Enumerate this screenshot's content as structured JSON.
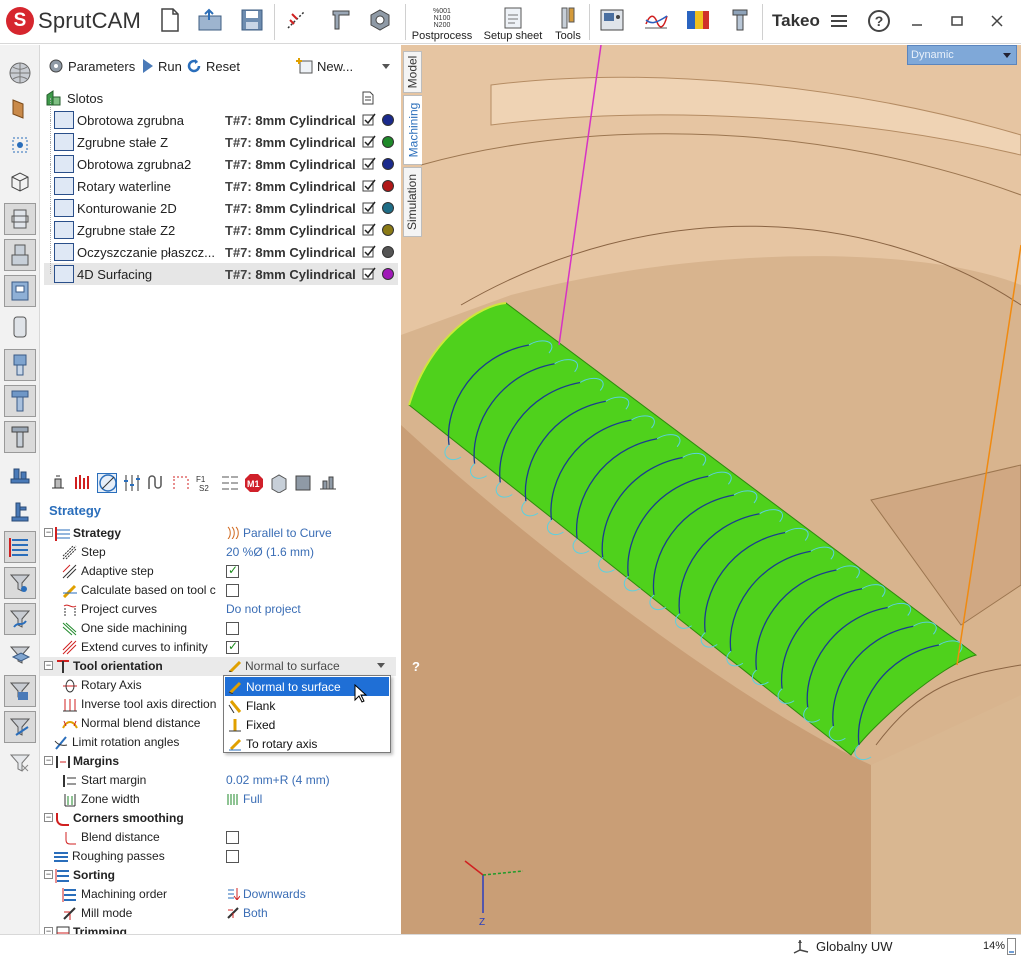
{
  "app": {
    "logo_letter": "S",
    "logo_text": "SprutCAM",
    "project_name": "Takeo"
  },
  "toolbar": {
    "postprocess_label": "Postprocess",
    "postprocess_code": [
      "%001",
      "N100",
      "N200"
    ],
    "setup_sheet_label": "Setup sheet",
    "tools_label": "Tools"
  },
  "op_toolbar": {
    "parameters": "Parameters",
    "run": "Run",
    "reset": "Reset",
    "new": "New..."
  },
  "tree": {
    "root": "Slotos",
    "operations": [
      {
        "name": "Obrotowa zgrubna",
        "tool_no": "T#7:",
        "tool": "8mm Cylindrical",
        "color": "#1a2a8c"
      },
      {
        "name": "Zgrubne stałe Z",
        "tool_no": "T#7:",
        "tool": "8mm Cylindrical",
        "color": "#1f8a2a"
      },
      {
        "name": "Obrotowa zgrubna2",
        "tool_no": "T#7:",
        "tool": "8mm Cylindrical",
        "color": "#1a2a8c"
      },
      {
        "name": "Rotary waterline",
        "tool_no": "T#7:",
        "tool": "8mm Cylindrical",
        "color": "#b01818"
      },
      {
        "name": "Konturowanie 2D",
        "tool_no": "T#7:",
        "tool": "8mm Cylindrical",
        "color": "#1f6d86"
      },
      {
        "name": "Zgrubne stałe Z2",
        "tool_no": "T#7:",
        "tool": "8mm Cylindrical",
        "color": "#8a7a16"
      },
      {
        "name": "Oczyszczanie płaszcz...",
        "tool_no": "T#7:",
        "tool": "8mm Cylindrical",
        "color": "#555555"
      },
      {
        "name": "4D Surfacing",
        "tool_no": "T#7:",
        "tool": "8mm Cylindrical",
        "color": "#a01ab8",
        "selected": true
      }
    ]
  },
  "section_title": "Strategy",
  "props": {
    "strategy": {
      "label": "Strategy",
      "value": "Parallel to Curve"
    },
    "step": {
      "label": "Step",
      "value": "20 %Ø (1.6 mm)"
    },
    "adaptive_step": {
      "label": "Adaptive step",
      "checked": true
    },
    "calc_based": {
      "label": "Calculate based on tool c",
      "checked": false
    },
    "project_curves": {
      "label": "Project curves",
      "value": "Do not project"
    },
    "one_side": {
      "label": "One side machining",
      "checked": false
    },
    "extend_curves": {
      "label": "Extend curves to infinity",
      "checked": true
    },
    "tool_orientation": {
      "label": "Tool orientation",
      "value": "Normal to surface"
    },
    "rotary_axis": {
      "label": "Rotary Axis"
    },
    "inverse_axis": {
      "label": "Inverse tool axis direction"
    },
    "normal_blend": {
      "label": "Normal blend distance"
    },
    "limit_rotation": {
      "label": "Limit rotation angles"
    },
    "margins": {
      "label": "Margins"
    },
    "start_margin": {
      "label": "Start margin",
      "value": "0.02 mm+R (4 mm)"
    },
    "zone_width": {
      "label": "Zone width",
      "value": "Full"
    },
    "corners": {
      "label": "Corners smoothing"
    },
    "blend_distance": {
      "label": "Blend distance",
      "checked": false
    },
    "roughing_passes": {
      "label": "Roughing passes",
      "checked": false
    },
    "sorting": {
      "label": "Sorting"
    },
    "machining_order": {
      "label": "Machining order",
      "value": "Downwards"
    },
    "mill_mode": {
      "label": "Mill mode",
      "value": "Both"
    },
    "trimming": {
      "label": "Trimming"
    }
  },
  "dropdown": {
    "options": [
      "Normal to surface",
      "Flank",
      "Fixed",
      "To rotary axis"
    ],
    "selected_index": 0
  },
  "viewport": {
    "tabs": [
      "Model",
      "Machining",
      "Simulation"
    ],
    "active_tab": "Machining",
    "view_mode": "Dynamic",
    "help_mark": "?",
    "axis_label": "Z",
    "part_color": "#d9b48f",
    "surface_color": "#4fd11c"
  },
  "status": {
    "coord_system": "Globalny UW",
    "zoom": "14%",
    "zoom_fraction": 0.14
  }
}
